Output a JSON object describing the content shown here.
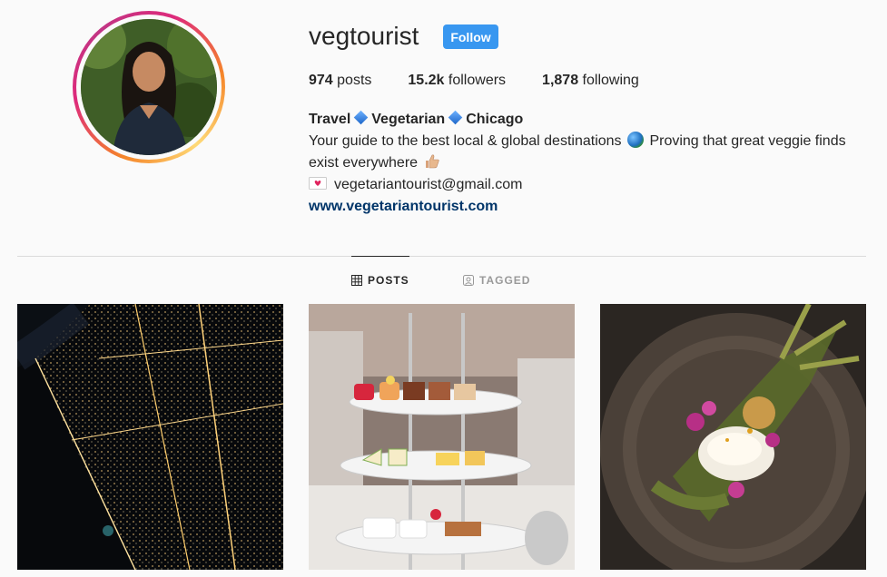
{
  "profile": {
    "username": "vegtourist",
    "follow_label": "Follow",
    "avatar_icon": "profile-photo"
  },
  "stats": {
    "posts_count": "974",
    "posts_label": "posts",
    "followers_count": "15.2k",
    "followers_label": "followers",
    "following_count": "1,878",
    "following_label": "following"
  },
  "bio": {
    "title_part1": "Travel",
    "title_part2": "Vegetarian",
    "title_part3": "Chicago",
    "line1": "Your guide to the best local & global destinations",
    "line1b": "Proving that great veggie finds",
    "line2": "exist everywhere",
    "email": "vegetariantourist@gmail.com",
    "website": "www.vegetariantourist.com"
  },
  "tabs": [
    {
      "label": "POSTS",
      "icon": "grid-icon",
      "active": true
    },
    {
      "label": "TAGGED",
      "icon": "tag-icon",
      "active": false
    }
  ],
  "posts": [
    {
      "icon": "city-night-photo"
    },
    {
      "icon": "afternoon-tea-photo"
    },
    {
      "icon": "plated-dish-photo"
    }
  ],
  "colors": {
    "follow_button": "#3897f0",
    "link": "#003569",
    "background": "#fafafa"
  }
}
